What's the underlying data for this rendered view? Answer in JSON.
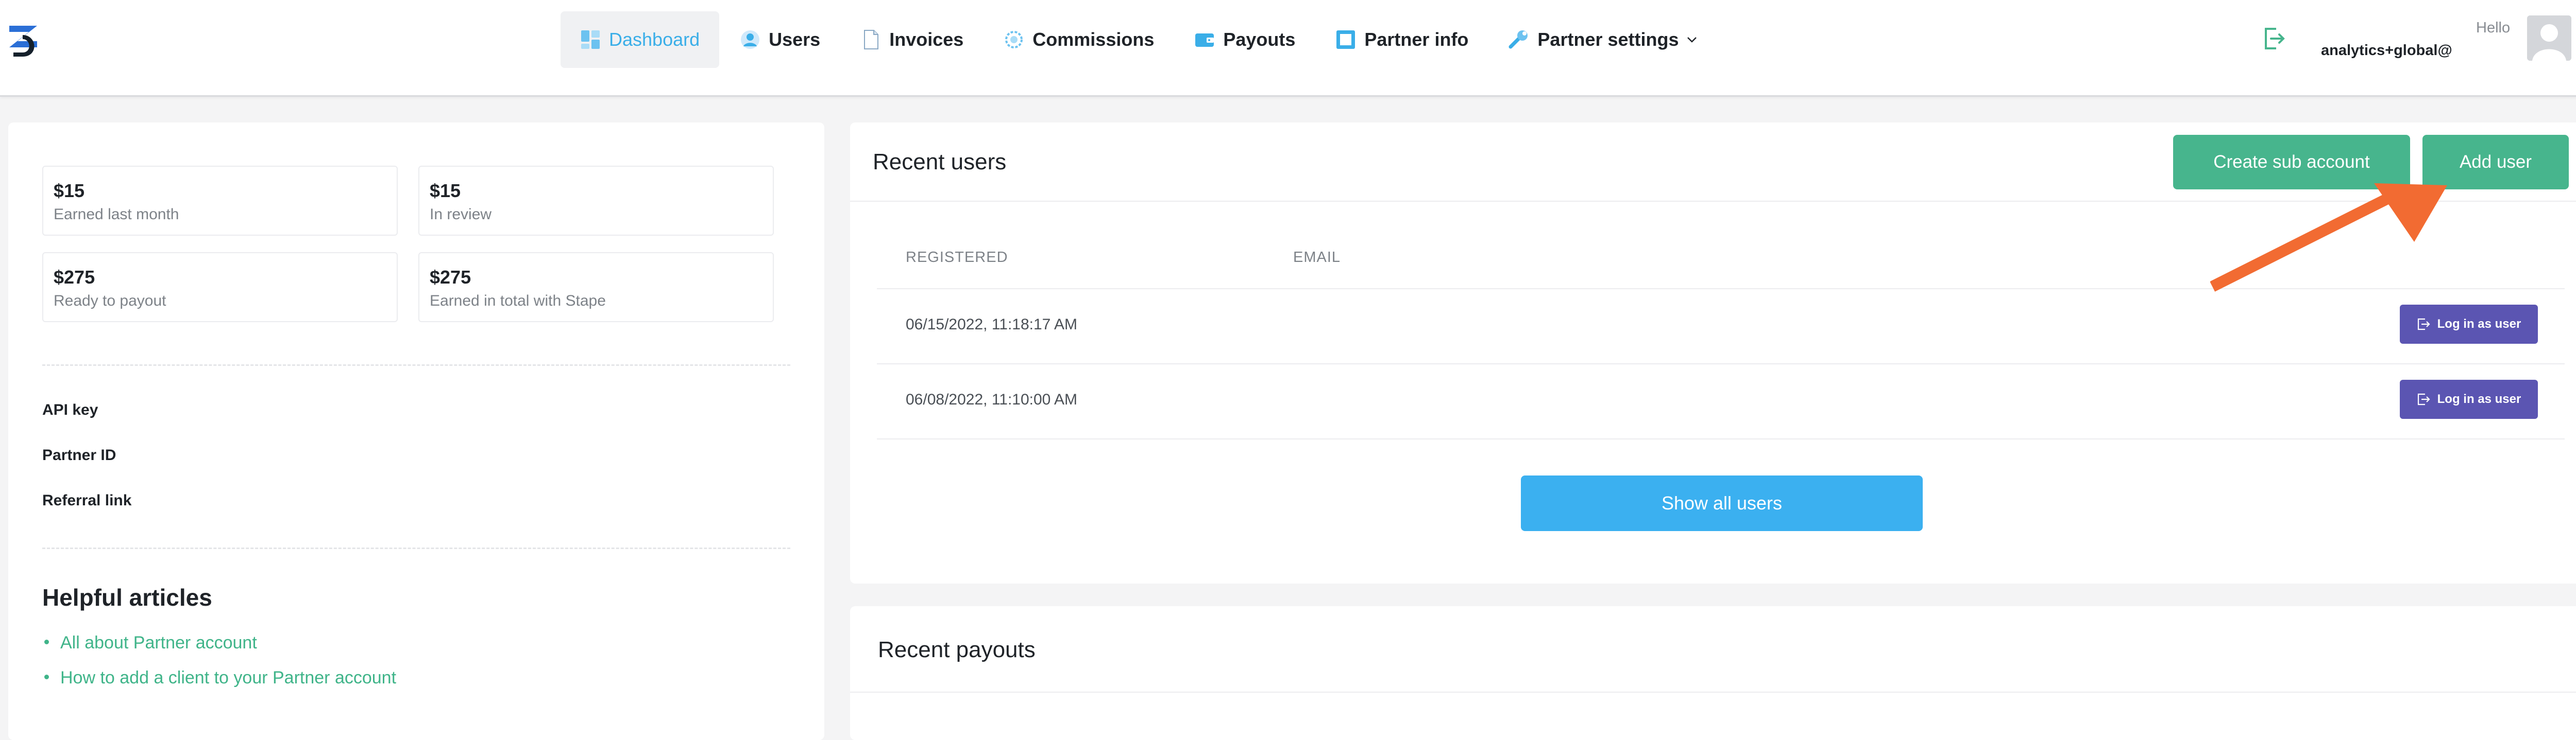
{
  "header": {
    "nav": [
      {
        "label": "Dashboard",
        "icon": "dashboard-icon",
        "active": true
      },
      {
        "label": "Users",
        "icon": "users-icon",
        "active": false
      },
      {
        "label": "Invoices",
        "icon": "invoices-icon",
        "active": false
      },
      {
        "label": "Commissions",
        "icon": "commissions-icon",
        "active": false
      },
      {
        "label": "Payouts",
        "icon": "payouts-icon",
        "active": false
      },
      {
        "label": "Partner info",
        "icon": "partner-info-icon",
        "active": false
      },
      {
        "label": "Partner settings",
        "icon": "wrench-icon",
        "active": false
      }
    ],
    "hello": "Hello",
    "user_email": "analytics+global@"
  },
  "stats": [
    {
      "value": "$15",
      "caption": "Earned last month"
    },
    {
      "value": "$15",
      "caption": "In review"
    },
    {
      "value": "$275",
      "caption": "Ready to payout"
    },
    {
      "value": "$275",
      "caption": "Earned in total with Stape"
    }
  ],
  "partner": {
    "api_key_label": "API key",
    "partner_id_label": "Partner ID",
    "referral_link_label": "Referral link"
  },
  "helpful": {
    "title": "Helpful articles",
    "articles": [
      "All about Partner account",
      "How to add a client to your Partner account"
    ]
  },
  "recent_users": {
    "title": "Recent users",
    "create_sub_label": "Create sub account",
    "add_user_label": "Add user",
    "columns": [
      "REGISTERED",
      "EMAIL"
    ],
    "rows": [
      {
        "registered": "06/15/2022, 11:18:17 AM",
        "action": "Log in as user"
      },
      {
        "registered": "06/08/2022, 11:10:00 AM",
        "action": "Log in as user"
      }
    ],
    "show_all_label": "Show all users"
  },
  "recent_payouts": {
    "title": "Recent payouts"
  },
  "colors": {
    "accent_blue": "#3bb0f0",
    "green": "#47b58d",
    "purple": "#5b55b2",
    "arrow_orange": "#f26b32"
  }
}
